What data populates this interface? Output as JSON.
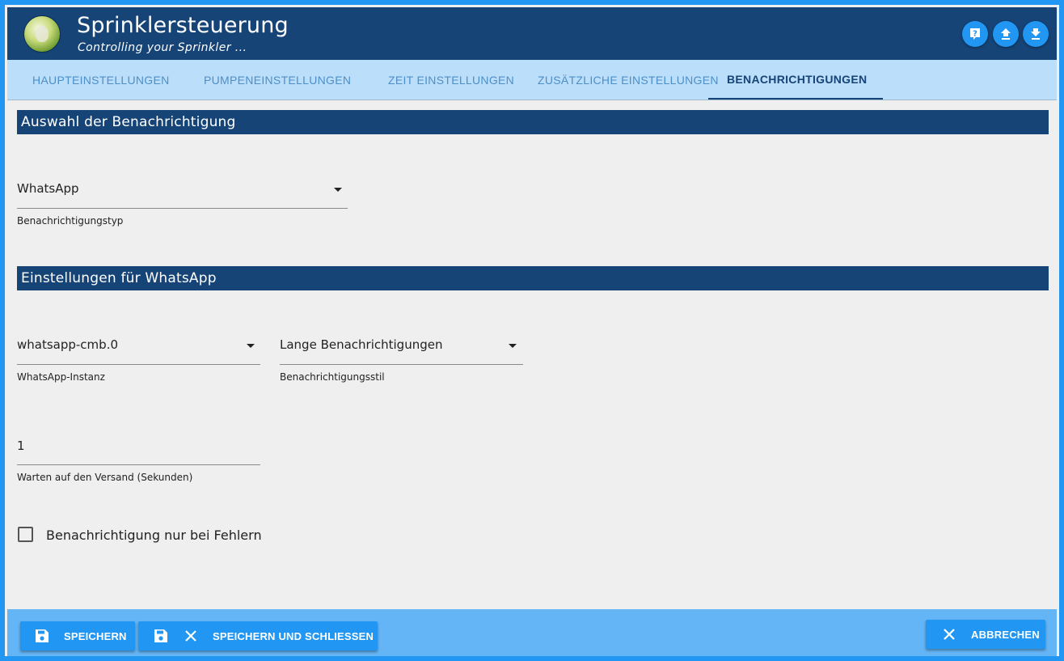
{
  "header": {
    "title": "Sprinklersteuerung",
    "subtitle": "Controlling your Sprinkler ...",
    "icons": [
      "help-icon",
      "upload-icon",
      "download-icon"
    ]
  },
  "tabs": [
    {
      "label": "Haupteinstellungen",
      "active": false
    },
    {
      "label": "Pumpeneinstellungen",
      "active": false
    },
    {
      "label": "Zeit Einstellungen",
      "active": false
    },
    {
      "label": "Zusätzliche Einstellungen",
      "active": false
    },
    {
      "label": "Benachrichtigungen",
      "active": true
    }
  ],
  "section1": {
    "title": "Auswahl der Benachrichtigung",
    "notification_type": {
      "value": "WhatsApp",
      "label": "Benachrichtigungstyp"
    }
  },
  "section2": {
    "title": "Einstellungen für WhatsApp",
    "instance": {
      "value": "whatsapp-cmb.0",
      "label": "WhatsApp-Instanz"
    },
    "style": {
      "value": "Lange Benachrichtigungen",
      "label": "Benachrichtigungsstil"
    },
    "wait": {
      "value": "1",
      "label": "Warten auf den Versand (Sekunden)"
    },
    "errors_only": {
      "label": "Benachrichtigung nur bei Fehlern",
      "checked": false
    }
  },
  "footer": {
    "save_label": "SPEICHERN",
    "save_close_label": "SPEICHERN UND SCHLIESSEN",
    "cancel_label": "ABBRECHEN"
  },
  "colors": {
    "primary_dark": "#164477",
    "primary": "#2196f3",
    "tab_bar": "#bbdefb",
    "footer": "#64b5f6",
    "background": "#efefef"
  }
}
